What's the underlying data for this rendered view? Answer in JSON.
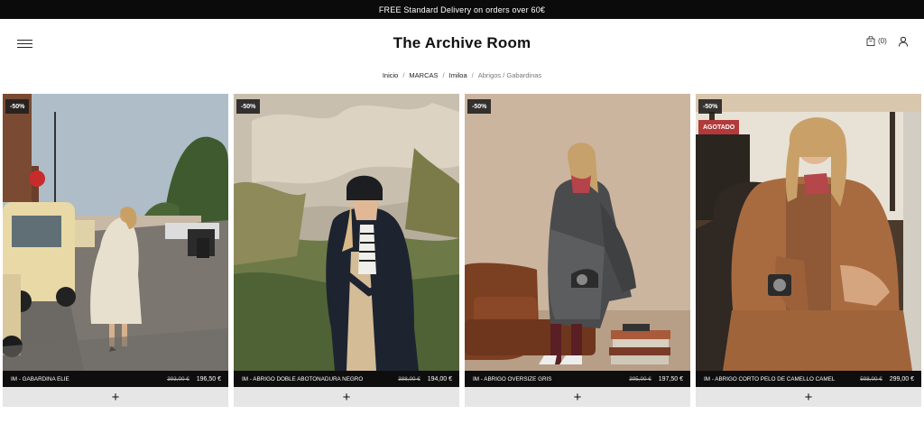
{
  "promo": {
    "text": "FREE Standard Delivery on orders over 60€"
  },
  "header": {
    "brand": "The Archive Room",
    "cart_count": "(0)",
    "icons": {
      "menu": "hamburger-menu-icon",
      "cart": "shopping-bag-icon",
      "user": "user-icon"
    }
  },
  "breadcrumb": {
    "items": [
      "Inicio",
      "MARCAS",
      "Imiloa"
    ],
    "separator": "/",
    "current": "Abrigos / Gabardinas"
  },
  "products": [
    {
      "badge": "-50%",
      "status": "",
      "name": "IM - GABARDINA ELIE",
      "old_price": "393,00 €",
      "price": "196,50 €",
      "add_label": "+"
    },
    {
      "badge": "-50%",
      "status": "",
      "name": "IM - ABRIGO DOBLE ABOTONADURA NEGRO",
      "old_price": "388,00 €",
      "price": "194,00 €",
      "add_label": "+"
    },
    {
      "badge": "-50%",
      "status": "",
      "name": "IM - ABRIGO OVERSIZE GRIS",
      "old_price": "395,00 €",
      "price": "197,50 €",
      "add_label": "+"
    },
    {
      "badge": "-50%",
      "status": "AGOTADO",
      "name": "IM - ABRIGO CORTO PELO DE CAMELLO CAMEL",
      "old_price": "598,00 €",
      "price": "299,00 €",
      "add_label": "+"
    }
  ],
  "colors": {
    "promo_bg": "#0b0b0b",
    "info_bar_bg": "#0e0e0e",
    "soldout_badge": "#b23a3a",
    "add_button_bg": "#e6e6e6"
  }
}
